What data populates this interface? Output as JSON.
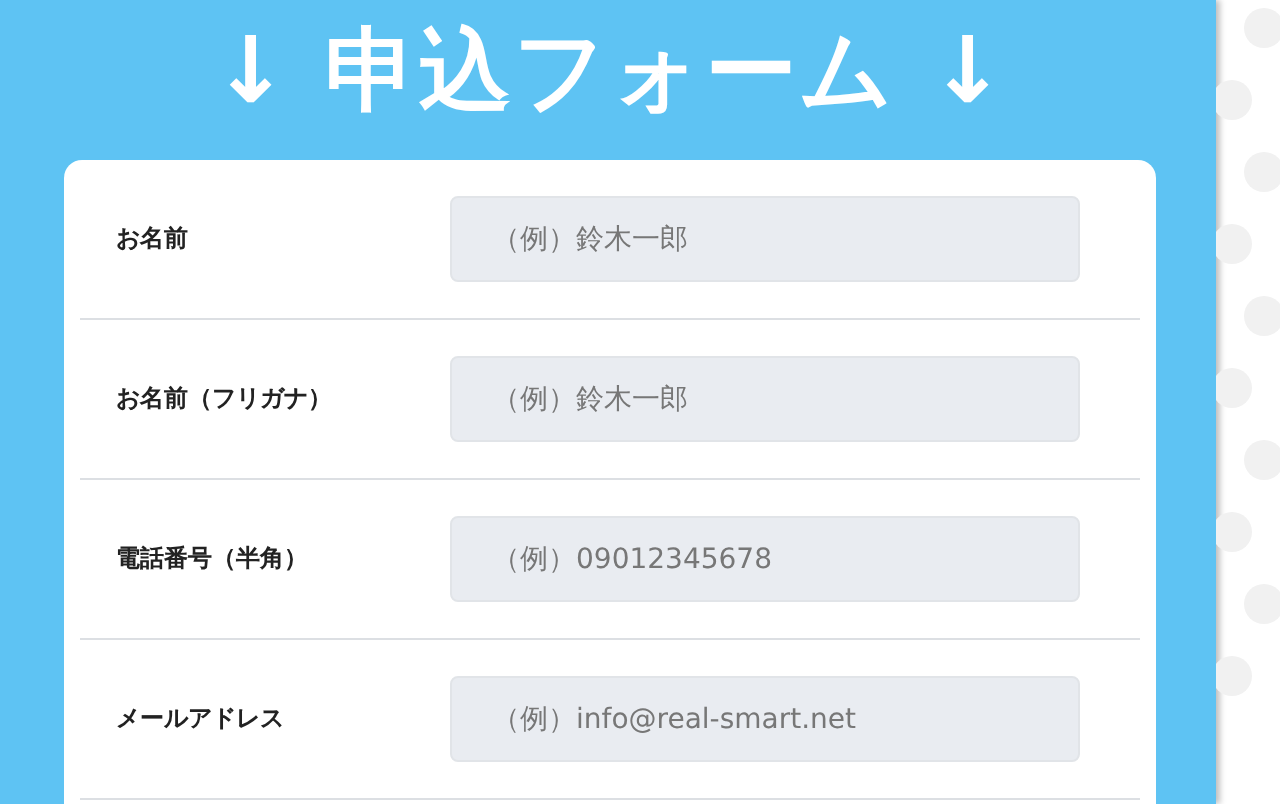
{
  "heading": "↓ 申込フォーム ↓",
  "fields": [
    {
      "label": "お名前",
      "placeholder": "（例）鈴木一郎"
    },
    {
      "label": "お名前（フリガナ）",
      "placeholder": "（例）鈴木一郎"
    },
    {
      "label": "電話番号（半角）",
      "placeholder": "（例）09012345678"
    },
    {
      "label": "メールアドレス",
      "placeholder": "（例）info@real-smart.net"
    }
  ]
}
